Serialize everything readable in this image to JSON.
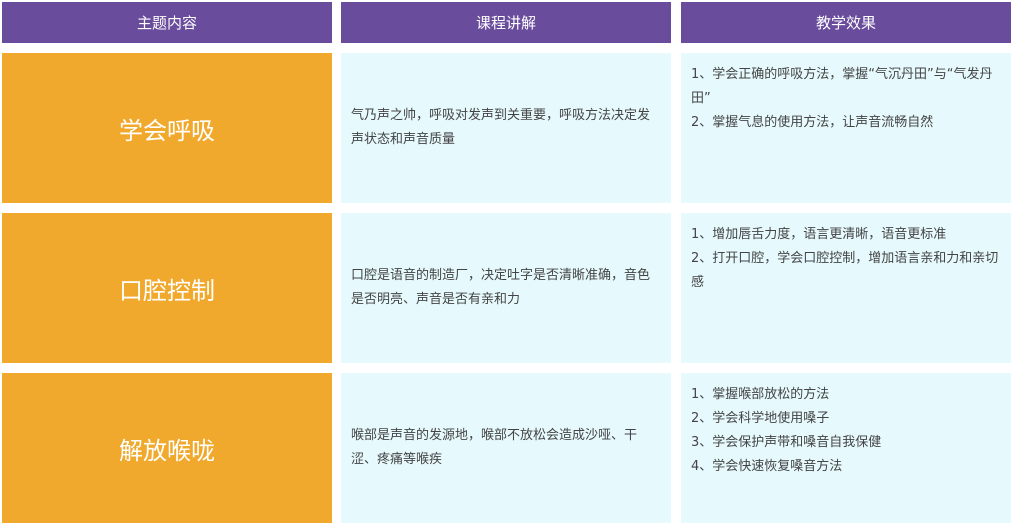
{
  "header": {
    "col1": "主题内容",
    "col2": "课程讲解",
    "col3": "教学效果"
  },
  "rows": [
    {
      "topic": "学会呼吸",
      "lecture": "气乃声之帅，呼吸对发声到关重要，呼吸方法决定发声状态和声音质量",
      "effects": [
        "1、学会正确的呼吸方法，掌握“气沉丹田”与“气发丹田”",
        "2、掌握气息的使用方法，让声音流畅自然"
      ]
    },
    {
      "topic": "口腔控制",
      "lecture": "口腔是语音的制造厂，决定吐字是否清晰准确，音色是否明亮、声音是否有亲和力",
      "effects": [
        "1、增加唇舌力度，语言更清晰，语音更标准",
        "2、打开口腔，学会口腔控制，增加语言亲和力和亲切感"
      ]
    },
    {
      "topic": "解放喉咙",
      "lecture": "喉部是声音的发源地，喉部不放松会造成沙哑、干涩、疼痛等喉疾",
      "effects": [
        "1、掌握喉部放松的方法",
        "2、学会科学地使用嗓子",
        "3、学会保护声带和嗓音自我保健",
        "4、学会快速恢复嗓音方法"
      ]
    }
  ],
  "colors": {
    "header_bg": "#6a4c9c",
    "topic_bg": "#f0a92c",
    "cell_bg": "#e6f9fd"
  }
}
